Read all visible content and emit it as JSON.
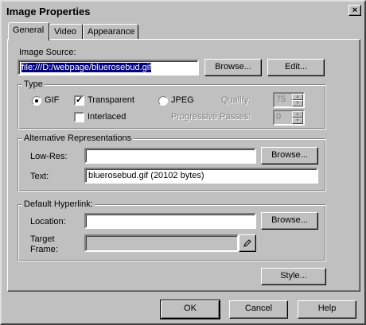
{
  "window": {
    "title": "Image Properties",
    "close_glyph": "×"
  },
  "tabs": [
    {
      "label": "General",
      "active": true
    },
    {
      "label": "Video",
      "active": false
    },
    {
      "label": "Appearance",
      "active": false
    }
  ],
  "image_source": {
    "label": "Image Source:",
    "value": "file:///D:/webpage/bluerosebud.gif",
    "browse_label": "Browse...",
    "edit_label": "Edit..."
  },
  "type_group": {
    "title": "Type",
    "gif_label": "GIF",
    "gif_selected": true,
    "transparent_label": "Transparent",
    "transparent_checked": true,
    "jpeg_label": "JPEG",
    "jpeg_selected": false,
    "interlaced_label": "Interlaced",
    "interlaced_checked": false,
    "quality_label": "Quality:",
    "quality_value": "75",
    "passes_label": "Progressive Passes:",
    "passes_value": "0"
  },
  "alt_group": {
    "title": "Alternative Representations",
    "lowres_label": "Low-Res:",
    "lowres_value": "",
    "browse_label": "Browse...",
    "text_label": "Text:",
    "text_value": "bluerosebud.gif (20102 bytes)"
  },
  "link_group": {
    "title": "Default Hyperlink:",
    "location_label": "Location:",
    "location_value": "",
    "browse_label": "Browse...",
    "target_label_1": "Target",
    "target_label_2": "Frame:",
    "target_value": ""
  },
  "style_label": "Style...",
  "footer": {
    "ok_label": "OK",
    "cancel_label": "Cancel",
    "help_label": "Help"
  }
}
